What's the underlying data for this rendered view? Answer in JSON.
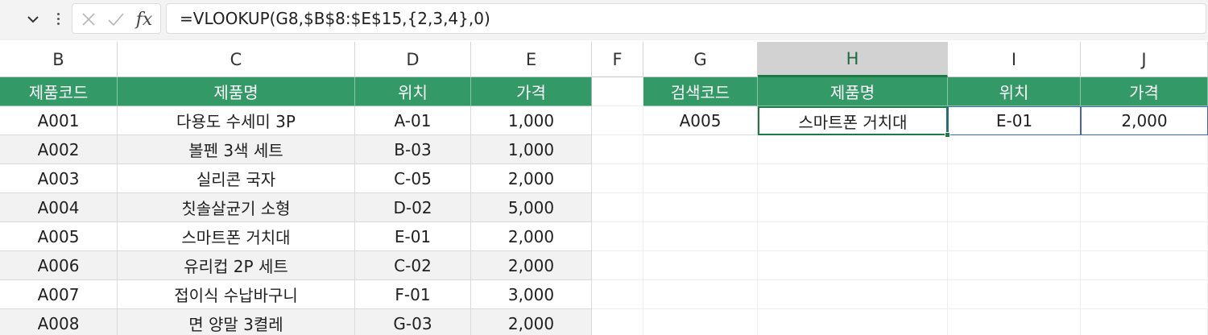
{
  "formula_bar": {
    "name_box_arrow_icon": "chevron-down-icon",
    "more_icon": "vertical-dots-icon",
    "cancel_icon": "x-icon",
    "enter_icon": "checkmark-icon",
    "fx_label": "fx",
    "formula": "=VLOOKUP(G8,$B$8:$E$15,{2,3,4},0)"
  },
  "columns": [
    "B",
    "C",
    "D",
    "E",
    "F",
    "G",
    "H",
    "I",
    "J"
  ],
  "selected_column": "H",
  "product_table": {
    "headers": [
      "제품코드",
      "제품명",
      "위치",
      "가격"
    ],
    "rows": [
      [
        "A001",
        "다용도 수세미 3P",
        "A-01",
        "1,000"
      ],
      [
        "A002",
        "볼펜 3색 세트",
        "B-03",
        "1,000"
      ],
      [
        "A003",
        "실리콘 국자",
        "C-05",
        "2,000"
      ],
      [
        "A004",
        "칫솔살균기 소형",
        "D-02",
        "5,000"
      ],
      [
        "A005",
        "스마트폰 거치대",
        "E-01",
        "2,000"
      ],
      [
        "A006",
        "유리컵 2P 세트",
        "C-02",
        "2,000"
      ],
      [
        "A007",
        "접이식 수납바구니",
        "F-01",
        "3,000"
      ],
      [
        "A008",
        "면 양말 3켤레",
        "G-03",
        "2,000"
      ]
    ]
  },
  "search_table": {
    "headers": [
      "검색코드",
      "제품명",
      "위치",
      "가격"
    ],
    "row": [
      "A005",
      "스마트폰 거치대",
      "E-01",
      "2,000"
    ]
  },
  "colors": {
    "header_green": "#339966",
    "selection_green": "#1d7a46",
    "spill_border_blue": "#3a66c4",
    "stripe_gray": "#f2f2f2"
  }
}
